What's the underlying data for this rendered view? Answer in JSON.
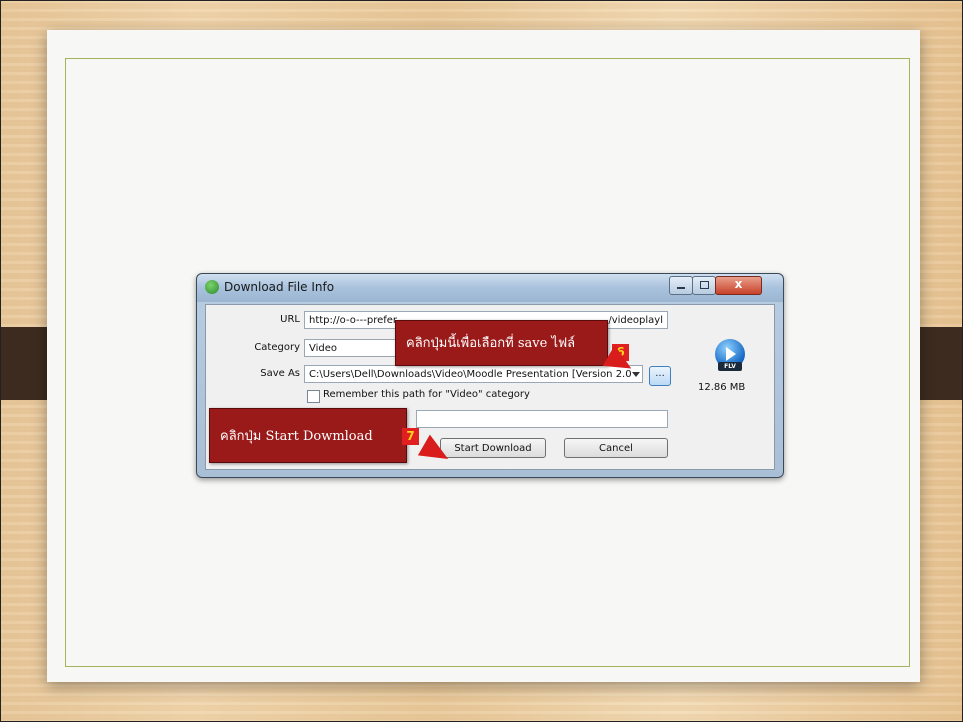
{
  "window": {
    "title": "Download File Info",
    "url_label": "URL",
    "url_value": "http://o-o---prefer",
    "url_value_tail": "/videoplayl",
    "category_label": "Category",
    "category_value": "Video",
    "saveas_label": "Save As",
    "saveas_value": "C:\\Users\\Dell\\Downloads\\Video\\Moodle Presentation [Version 2.0",
    "browse_label": "...",
    "remember_label": "Remember this path for \"Video\" category",
    "start_button": "Start Download",
    "cancel_button": "Cancel",
    "file_type": "FLV",
    "file_size": "12.86 MB"
  },
  "callouts": {
    "step6_text": "คลิกปุ่มนี้เพื่อเลือกที่ save ไฟล์",
    "step6_number": "6",
    "step7_text": "คลิกปุ่ม Start Dowmload",
    "step7_number": "7"
  },
  "colors": {
    "callout_bg": "#9a1a1a",
    "arrow": "#d91c1c",
    "slide_border": "#a6b25a"
  }
}
